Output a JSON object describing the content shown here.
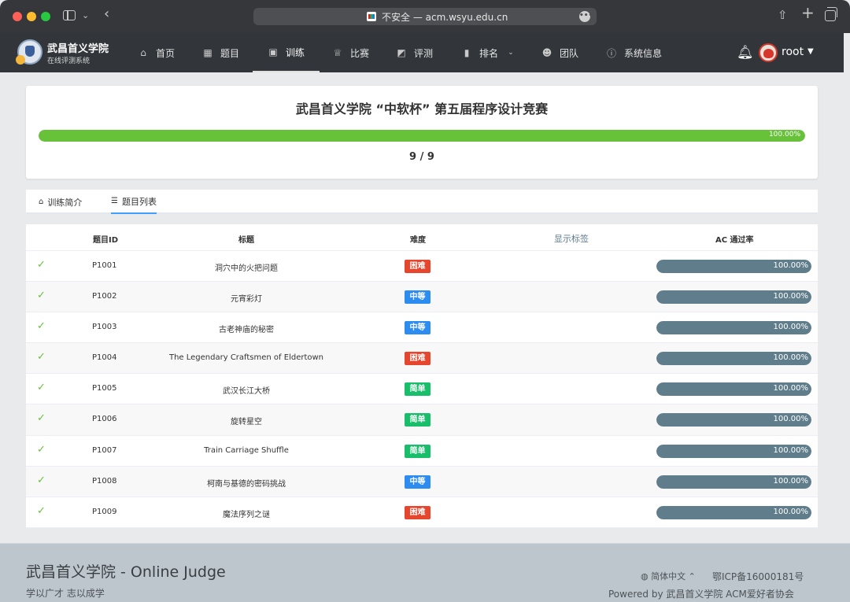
{
  "browser": {
    "url_text": "不安全 — acm.wsyu.edu.cn",
    "more_label": "•••"
  },
  "nav": {
    "brand_title": "武昌首义学院",
    "brand_subtitle": "在线评测系统",
    "items": [
      {
        "label": "首页",
        "icon": "home-icon"
      },
      {
        "label": "题目",
        "icon": "grid-icon"
      },
      {
        "label": "训练",
        "icon": "clipboard-icon"
      },
      {
        "label": "比赛",
        "icon": "trophy-icon"
      },
      {
        "label": "评测",
        "icon": "chart-area-icon"
      },
      {
        "label": "排名",
        "icon": "bar-chart-icon"
      },
      {
        "label": "团队",
        "icon": "users-icon"
      },
      {
        "label": "系统信息",
        "icon": "info-icon"
      }
    ],
    "active_item": "训练",
    "username": "root"
  },
  "contest": {
    "title": "武昌首义学院 “中软杯” 第五届程序设计竞赛",
    "progress_percent": 100,
    "progress_text": "100.00%",
    "solved_text": "9 / 9"
  },
  "tabs": [
    {
      "label": "训练简介",
      "icon": "home-icon"
    },
    {
      "label": "题目列表",
      "icon": "list-icon"
    }
  ],
  "active_tab": "题目列表",
  "table": {
    "headers": {
      "id": "题目ID",
      "title": "标题",
      "difficulty": "难度",
      "show_tags": "显示标签",
      "ac_rate": "AC 通过率"
    },
    "rows": [
      {
        "id": "P1001",
        "title": "洞穴中的火把问题",
        "difficulty": "困难",
        "ac_rate_text": "100.00%",
        "ac_rate": 100
      },
      {
        "id": "P1002",
        "title": "元宵彩灯",
        "difficulty": "中等",
        "ac_rate_text": "100.00%",
        "ac_rate": 100
      },
      {
        "id": "P1003",
        "title": "古老神庙的秘密",
        "difficulty": "中等",
        "ac_rate_text": "100.00%",
        "ac_rate": 100
      },
      {
        "id": "P1004",
        "title": "The Legendary Craftsmen of Eldertown",
        "difficulty": "困难",
        "ac_rate_text": "100.00%",
        "ac_rate": 100
      },
      {
        "id": "P1005",
        "title": "武汉长江大桥",
        "difficulty": "简单",
        "ac_rate_text": "100.00%",
        "ac_rate": 100
      },
      {
        "id": "P1006",
        "title": "旋转星空",
        "difficulty": "简单",
        "ac_rate_text": "100.00%",
        "ac_rate": 100
      },
      {
        "id": "P1007",
        "title": "Train Carriage Shuffle",
        "difficulty": "简单",
        "ac_rate_text": "100.00%",
        "ac_rate": 100
      },
      {
        "id": "P1008",
        "title": "柯南与基德的密码挑战",
        "difficulty": "中等",
        "ac_rate_text": "100.00%",
        "ac_rate": 100
      },
      {
        "id": "P1009",
        "title": "魔法序列之谜",
        "difficulty": "困难",
        "ac_rate_text": "100.00%",
        "ac_rate": 100
      }
    ]
  },
  "difficulty_colors": {
    "困难": "#e6452e",
    "中等": "#2d8cf0",
    "简单": "#19be6b"
  },
  "footer": {
    "title": "武昌首义学院 - Online Judge",
    "slogan": "学以广才 志以成学",
    "language": "简体中文",
    "icp": "鄂ICP备16000181号",
    "powered_by": "Powered by 武昌首义学院 ACM爱好者协会"
  }
}
